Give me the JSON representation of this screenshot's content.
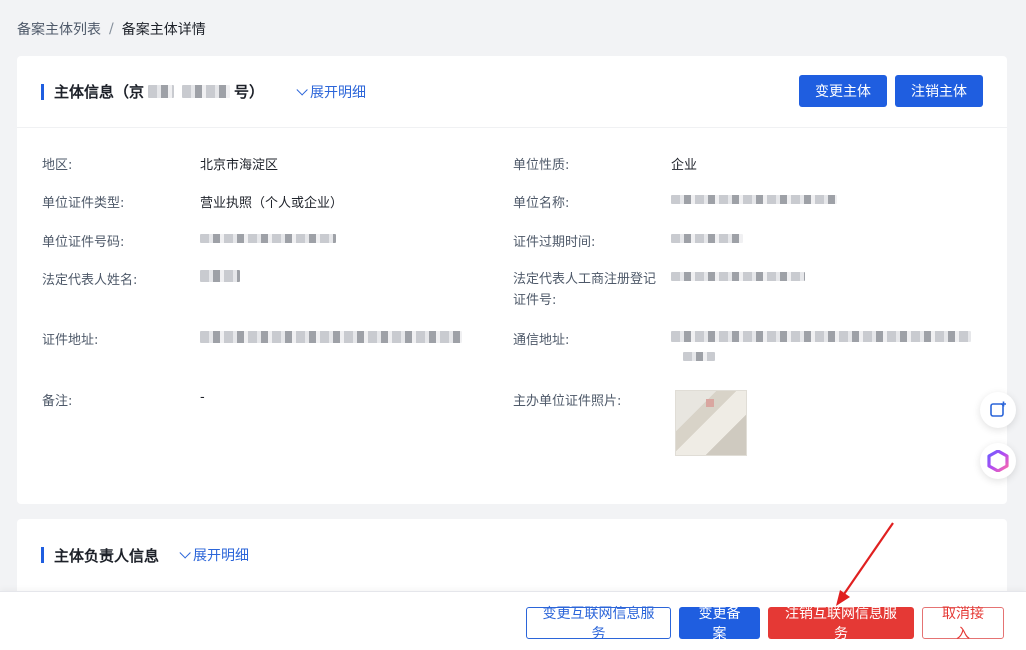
{
  "breadcrumb": {
    "parent": "备案主体列表",
    "separator": "/",
    "current": "备案主体详情"
  },
  "main_card": {
    "title_prefix": "主体信息（京",
    "title_suffix": "号）",
    "expand_label": "展开明细",
    "change_button": "变更主体",
    "cancel_button": "注销主体"
  },
  "fields": {
    "region_label": "地区:",
    "region_value": "北京市海淀区",
    "nature_label": "单位性质:",
    "nature_value": "企业",
    "cert_type_label": "单位证件类型:",
    "cert_type_value": "营业执照（个人或企业）",
    "unit_name_label": "单位名称:",
    "cert_no_label": "单位证件号码:",
    "expire_label": "证件过期时间:",
    "legal_name_label": "法定代表人姓名:",
    "legal_reg_label_line1": "法定代表人工商注册登记",
    "legal_reg_label_line2": "证件号:",
    "cert_addr_label": "证件地址:",
    "contact_addr_label": "通信地址:",
    "remark_label": "备注:",
    "remark_value": "-",
    "photo_label": "主办单位证件照片:"
  },
  "second_card": {
    "title": "主体负责人信息",
    "expand_label": "展开明细"
  },
  "footer": {
    "change_service": "变更互联网信息服务",
    "change_record": "变更备案",
    "cancel_service": "注销互联网信息服务",
    "cancel_access": "取消接入"
  },
  "colors": {
    "primary": "#1f5ee0",
    "danger": "#e53935",
    "annotation_arrow": "#e02020"
  }
}
